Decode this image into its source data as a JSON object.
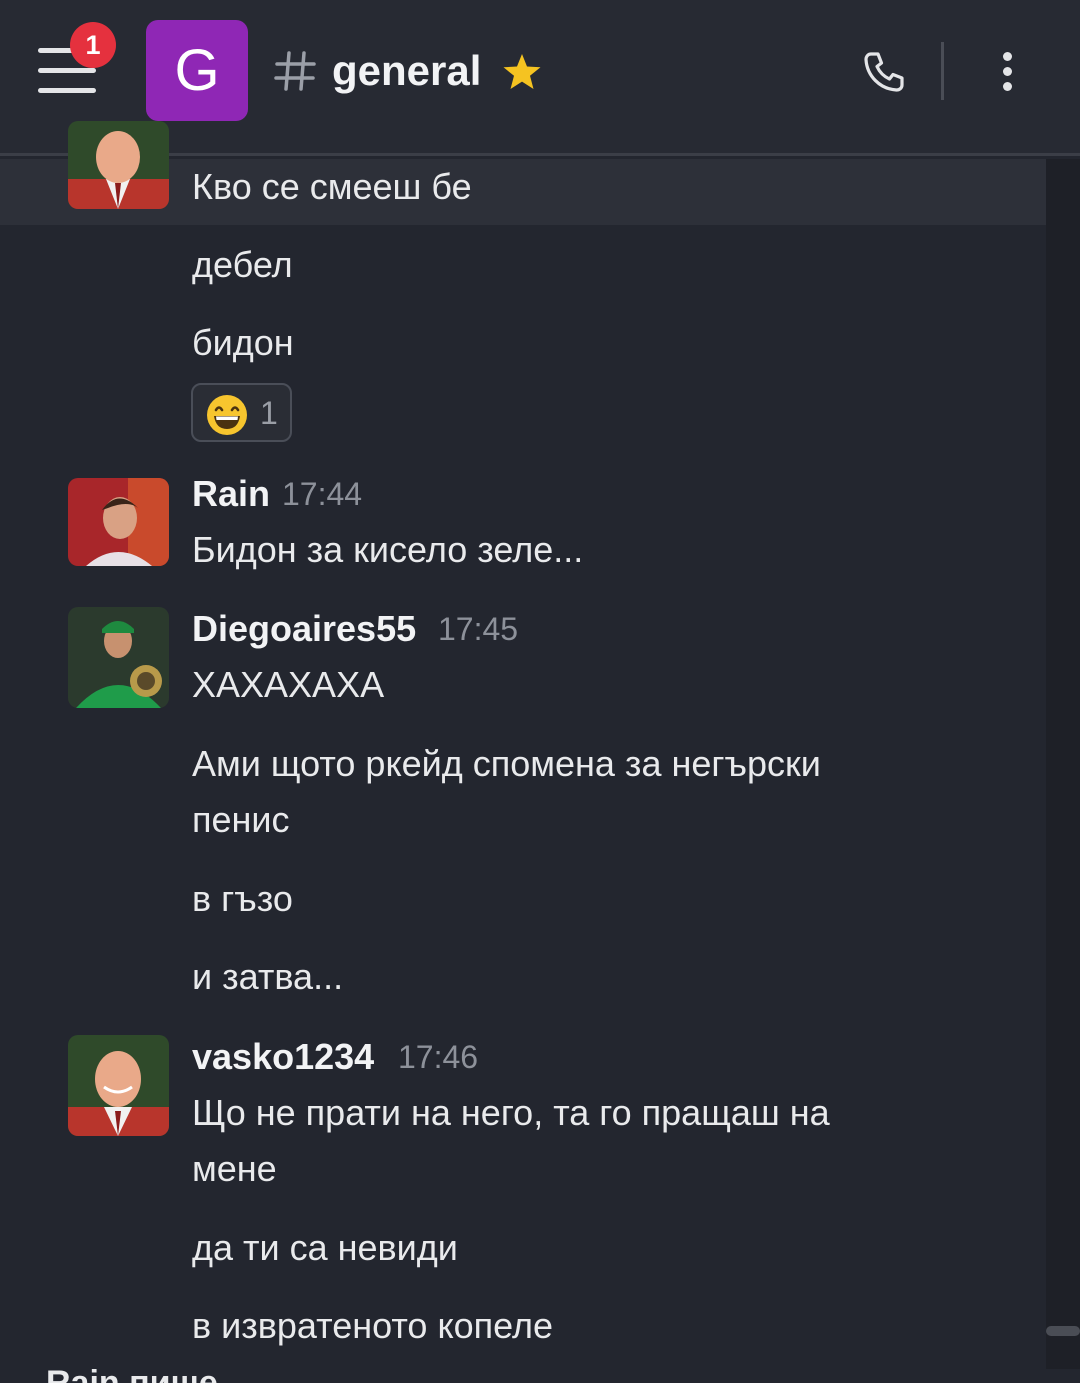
{
  "header": {
    "notification_count": "1",
    "server_initial": "G",
    "channel_name": "general",
    "icons": [
      "menu-icon",
      "hash-icon",
      "star-icon",
      "phone-icon",
      "more-vertical-icon"
    ]
  },
  "messages": {
    "m1": {
      "lines": [
        "Кво се смееш бе",
        "дебел",
        "бидон"
      ],
      "reaction": {
        "emoji": "grinning-face",
        "count": "1"
      }
    },
    "m2": {
      "author": "Rain",
      "time": "17:44",
      "lines": [
        "Бидон за кисело зеле..."
      ]
    },
    "m3": {
      "author": "Diegoaires55",
      "time": "17:45",
      "lines": [
        "ХАХАХАХА",
        "Ами щото ркейд спомена за негърски",
        "пенис",
        "в гъзо",
        "и затва..."
      ]
    },
    "m4": {
      "author": "vasko1234",
      "time": "17:46",
      "lines": [
        "Що не прати на него, та го пращаш на",
        "мене",
        "да ти са невиди",
        "в извратеното копеле"
      ]
    }
  },
  "typing_indicator": "Rain пише...",
  "colors": {
    "accent_server": "#8f27b5",
    "badge": "#e5313e",
    "star": "#f5c321",
    "background": "#23262f"
  }
}
